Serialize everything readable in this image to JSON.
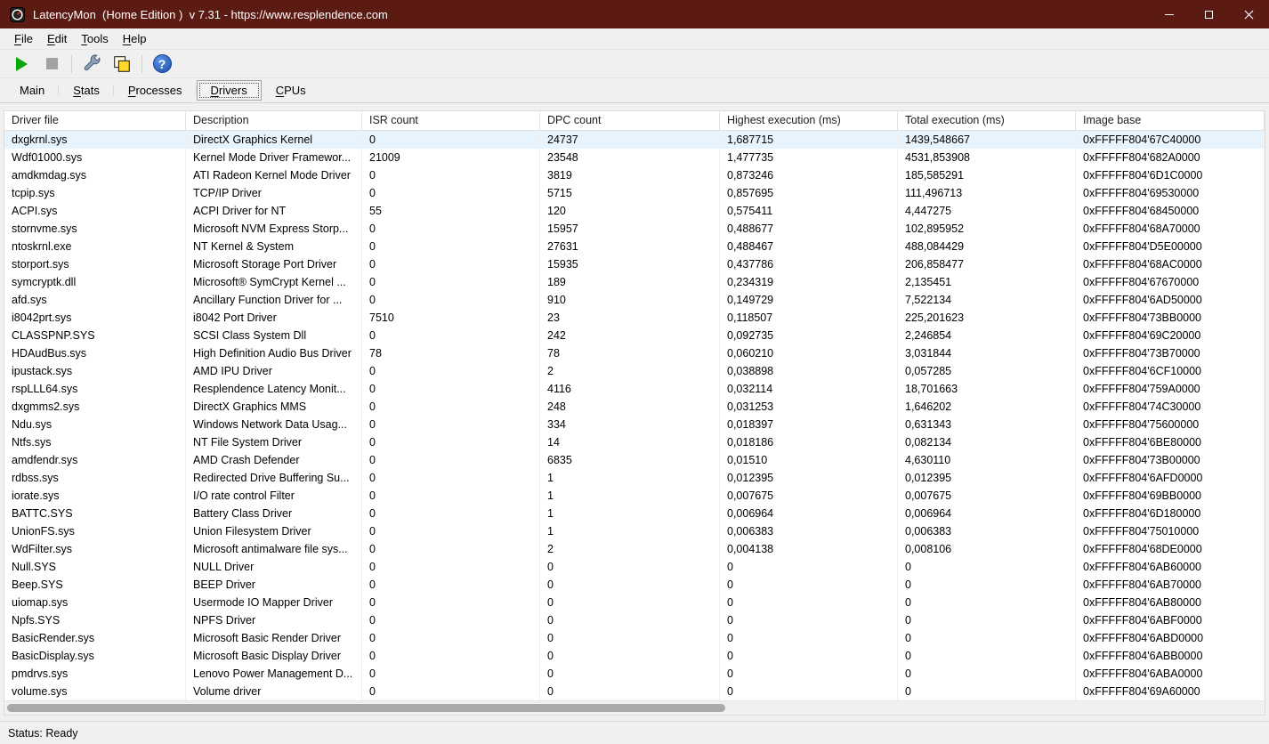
{
  "window": {
    "title": "LatencyMon  (Home Edition )  v 7.31 - https://www.resplendence.com",
    "controls": [
      "minimize",
      "maximize",
      "close"
    ]
  },
  "menu": {
    "items": [
      {
        "label": "File",
        "accel": true
      },
      {
        "label": "Edit",
        "accel": true
      },
      {
        "label": "Tools",
        "accel": true
      },
      {
        "label": "Help",
        "accel": true
      }
    ]
  },
  "toolbar": {
    "buttons": [
      {
        "name": "start-monitor-button",
        "icon": "play-icon",
        "enabled": true
      },
      {
        "name": "stop-monitor-button",
        "icon": "stop-icon",
        "enabled": false
      },
      {
        "name": "tools-button",
        "icon": "wrench-icon",
        "enabled": true
      },
      {
        "name": "copy-report-button",
        "icon": "copy-icon",
        "enabled": true
      },
      {
        "name": "help-button",
        "icon": "help-icon",
        "enabled": true
      }
    ]
  },
  "tabs": [
    {
      "label": "Main",
      "accel": false,
      "selected": false
    },
    {
      "label": "Stats",
      "accel": true,
      "selected": false
    },
    {
      "label": "Processes",
      "accel": true,
      "selected": false
    },
    {
      "label": "Drivers",
      "accel": true,
      "selected": true
    },
    {
      "label": "CPUs",
      "accel": true,
      "selected": false
    }
  ],
  "table": {
    "columns": [
      "Driver file",
      "Description",
      "ISR count",
      "DPC count",
      "Highest execution (ms)",
      "Total execution (ms)",
      "Image base"
    ],
    "selected_row": 0,
    "rows": [
      [
        "dxgkrnl.sys",
        "DirectX Graphics Kernel",
        "0",
        "24737",
        "1,687715",
        "1439,548667",
        "0xFFFFF804'67C40000"
      ],
      [
        "Wdf01000.sys",
        "Kernel Mode Driver Framewor...",
        "21009",
        "23548",
        "1,477735",
        "4531,853908",
        "0xFFFFF804'682A0000"
      ],
      [
        "amdkmdag.sys",
        "ATI Radeon Kernel Mode Driver",
        "0",
        "3819",
        "0,873246",
        "185,585291",
        "0xFFFFF804'6D1C0000"
      ],
      [
        "tcpip.sys",
        "TCP/IP Driver",
        "0",
        "5715",
        "0,857695",
        "111,496713",
        "0xFFFFF804'69530000"
      ],
      [
        "ACPI.sys",
        "ACPI Driver for NT",
        "55",
        "120",
        "0,575411",
        "4,447275",
        "0xFFFFF804'68450000"
      ],
      [
        "stornvme.sys",
        "Microsoft NVM Express Storp...",
        "0",
        "15957",
        "0,488677",
        "102,895952",
        "0xFFFFF804'68A70000"
      ],
      [
        "ntoskrnl.exe",
        "NT Kernel & System",
        "0",
        "27631",
        "0,488467",
        "488,084429",
        "0xFFFFF804'D5E00000"
      ],
      [
        "storport.sys",
        "Microsoft Storage Port Driver",
        "0",
        "15935",
        "0,437786",
        "206,858477",
        "0xFFFFF804'68AC0000"
      ],
      [
        "symcryptk.dll",
        "Microsoft® SymCrypt Kernel ...",
        "0",
        "189",
        "0,234319",
        "2,135451",
        "0xFFFFF804'67670000"
      ],
      [
        "afd.sys",
        "Ancillary Function Driver for ...",
        "0",
        "910",
        "0,149729",
        "7,522134",
        "0xFFFFF804'6AD50000"
      ],
      [
        "i8042prt.sys",
        "i8042 Port Driver",
        "7510",
        "23",
        "0,118507",
        "225,201623",
        "0xFFFFF804'73BB0000"
      ],
      [
        "CLASSPNP.SYS",
        "SCSI Class System Dll",
        "0",
        "242",
        "0,092735",
        "2,246854",
        "0xFFFFF804'69C20000"
      ],
      [
        "HDAudBus.sys",
        "High Definition Audio Bus Driver",
        "78",
        "78",
        "0,060210",
        "3,031844",
        "0xFFFFF804'73B70000"
      ],
      [
        "ipustack.sys",
        "AMD IPU Driver",
        "0",
        "2",
        "0,038898",
        "0,057285",
        "0xFFFFF804'6CF10000"
      ],
      [
        "rspLLL64.sys",
        "Resplendence Latency Monit...",
        "0",
        "4116",
        "0,032114",
        "18,701663",
        "0xFFFFF804'759A0000"
      ],
      [
        "dxgmms2.sys",
        "DirectX Graphics MMS",
        "0",
        "248",
        "0,031253",
        "1,646202",
        "0xFFFFF804'74C30000"
      ],
      [
        "Ndu.sys",
        "Windows Network Data Usag...",
        "0",
        "334",
        "0,018397",
        "0,631343",
        "0xFFFFF804'75600000"
      ],
      [
        "Ntfs.sys",
        "NT File System Driver",
        "0",
        "14",
        "0,018186",
        "0,082134",
        "0xFFFFF804'6BE80000"
      ],
      [
        "amdfendr.sys",
        "AMD Crash Defender",
        "0",
        "6835",
        "0,01510",
        "4,630110",
        "0xFFFFF804'73B00000"
      ],
      [
        "rdbss.sys",
        "Redirected Drive Buffering Su...",
        "0",
        "1",
        "0,012395",
        "0,012395",
        "0xFFFFF804'6AFD0000"
      ],
      [
        "iorate.sys",
        "I/O rate control Filter",
        "0",
        "1",
        "0,007675",
        "0,007675",
        "0xFFFFF804'69BB0000"
      ],
      [
        "BATTC.SYS",
        "Battery Class Driver",
        "0",
        "1",
        "0,006964",
        "0,006964",
        "0xFFFFF804'6D180000"
      ],
      [
        "UnionFS.sys",
        "Union Filesystem Driver",
        "0",
        "1",
        "0,006383",
        "0,006383",
        "0xFFFFF804'75010000"
      ],
      [
        "WdFilter.sys",
        "Microsoft antimalware file sys...",
        "0",
        "2",
        "0,004138",
        "0,008106",
        "0xFFFFF804'68DE0000"
      ],
      [
        "Null.SYS",
        "NULL Driver",
        "0",
        "0",
        "0",
        "0",
        "0xFFFFF804'6AB60000"
      ],
      [
        "Beep.SYS",
        "BEEP Driver",
        "0",
        "0",
        "0",
        "0",
        "0xFFFFF804'6AB70000"
      ],
      [
        "uiomap.sys",
        "Usermode IO Mapper Driver",
        "0",
        "0",
        "0",
        "0",
        "0xFFFFF804'6AB80000"
      ],
      [
        "Npfs.SYS",
        "NPFS Driver",
        "0",
        "0",
        "0",
        "0",
        "0xFFFFF804'6ABF0000"
      ],
      [
        "BasicRender.sys",
        "Microsoft Basic Render Driver",
        "0",
        "0",
        "0",
        "0",
        "0xFFFFF804'6ABD0000"
      ],
      [
        "BasicDisplay.sys",
        "Microsoft Basic Display Driver",
        "0",
        "0",
        "0",
        "0",
        "0xFFFFF804'6ABB0000"
      ],
      [
        "pmdrvs.sys",
        "Lenovo Power Management D...",
        "0",
        "0",
        "0",
        "0",
        "0xFFFFF804'6ABA0000"
      ],
      [
        "volume.sys",
        "Volume driver",
        "0",
        "0",
        "0",
        "0",
        "0xFFFFF804'69A60000"
      ]
    ]
  },
  "scrollbar": {
    "thumb_percent": 57
  },
  "status": {
    "text": "Status: Ready"
  },
  "colors": {
    "titlebar": "#5c1b12",
    "selection": "#e8f4fd"
  }
}
